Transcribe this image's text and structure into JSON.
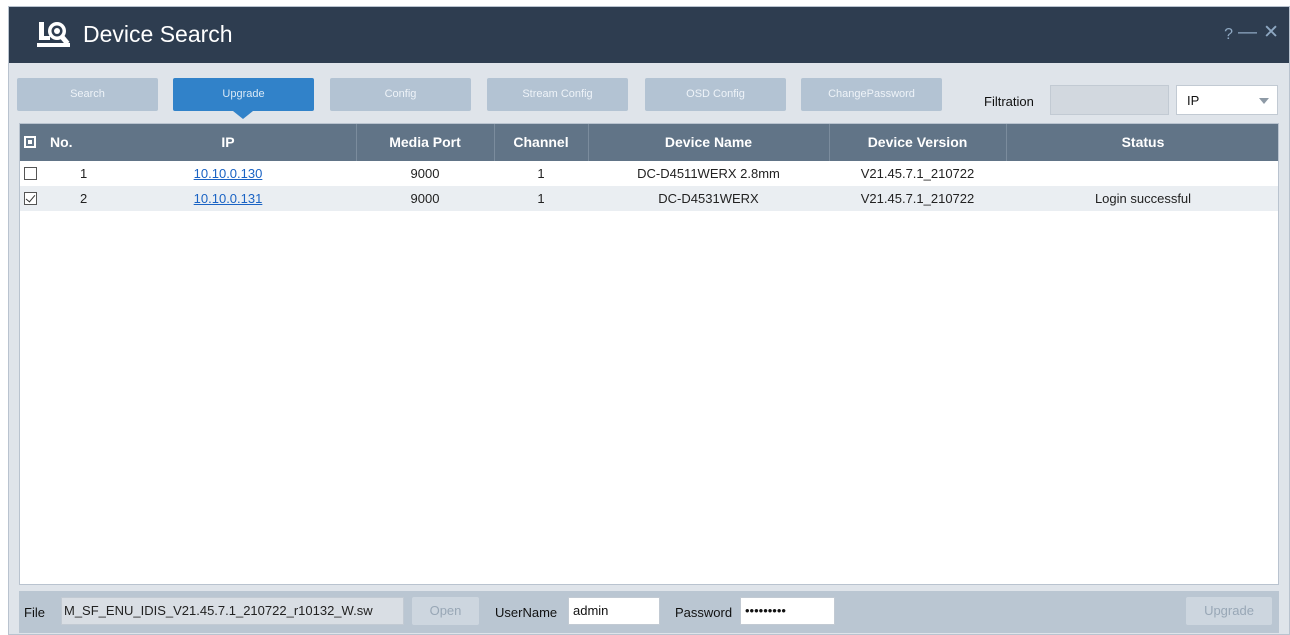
{
  "window": {
    "title": "Device Search",
    "help_glyph": "?",
    "minimize_glyph": "—",
    "close_glyph": "✕"
  },
  "toolbar": {
    "buttons": [
      {
        "label": "Search",
        "active": false
      },
      {
        "label": "Upgrade",
        "active": true
      },
      {
        "label": "Config",
        "active": false
      },
      {
        "label": "Stream Config",
        "active": false
      },
      {
        "label": "OSD Config",
        "active": false
      },
      {
        "label": "ChangePassword",
        "active": false
      }
    ],
    "filtration_label": "Filtration",
    "filtration_value": "",
    "filter_select_value": "IP"
  },
  "table": {
    "columns": [
      "No.",
      "IP",
      "Media Port",
      "Channel",
      "Device Name",
      "Device Version",
      "Status"
    ],
    "header_checkbox_state": "partial",
    "rows": [
      {
        "checked": false,
        "no": "1",
        "ip": "10.10.0.130",
        "media_port": "9000",
        "channel": "1",
        "device_name": "DC-D4511WERX 2.8mm",
        "device_version": "V21.45.7.1_210722",
        "status": ""
      },
      {
        "checked": true,
        "no": "2",
        "ip": "10.10.0.131",
        "media_port": "9000",
        "channel": "1",
        "device_name": "DC-D4531WERX",
        "device_version": "V21.45.7.1_210722",
        "status": "Login successful"
      }
    ]
  },
  "bottom": {
    "file_label": "File",
    "file_value": "M_SF_ENU_IDIS_V21.45.7.1_210722_r10132_W.sw",
    "open_label": "Open",
    "username_label": "UserName",
    "username_value": "admin",
    "password_label": "Password",
    "password_value": "•••••••••",
    "upgrade_label": "Upgrade"
  },
  "colors": {
    "titlebar": "#2e3d50",
    "accent": "#3182c9",
    "table_header": "#617487",
    "link": "#1a63c4"
  }
}
